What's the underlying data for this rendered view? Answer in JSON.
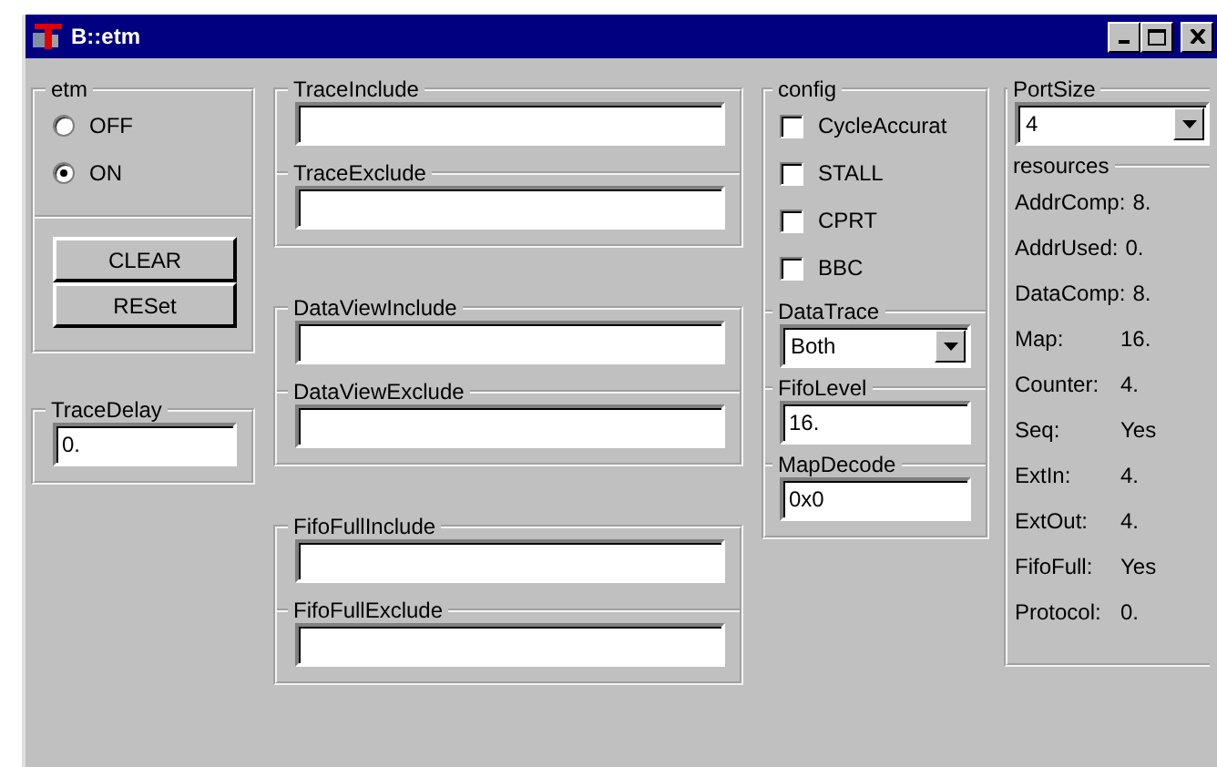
{
  "window": {
    "title": "B::etm"
  },
  "etm": {
    "label": "etm",
    "options": [
      {
        "label": "OFF",
        "selected": false
      },
      {
        "label": "ON",
        "selected": true
      }
    ],
    "buttons": [
      "CLEAR",
      "RESet"
    ]
  },
  "trace_delay": {
    "label": "TraceDelay",
    "value": "0."
  },
  "filter_groups": [
    {
      "fields": [
        {
          "label": "TraceInclude"
        },
        {
          "label": "TraceExclude"
        }
      ]
    },
    {
      "fields": [
        {
          "label": "DataViewInclude"
        },
        {
          "label": "DataViewExclude"
        }
      ]
    },
    {
      "fields": [
        {
          "label": "FifoFullInclude"
        },
        {
          "label": "FifoFullExclude"
        }
      ]
    }
  ],
  "config": {
    "label": "config",
    "options": [
      {
        "label": "CycleAccurat",
        "checked": false
      },
      {
        "label": "STALL",
        "checked": false
      },
      {
        "label": "CPRT",
        "checked": false
      },
      {
        "label": "BBC",
        "checked": false
      }
    ],
    "data_trace": {
      "label": "DataTrace",
      "value": "Both"
    },
    "fifo_level": {
      "label": "FifoLevel",
      "value": "16."
    },
    "map_decode": {
      "label": "MapDecode",
      "value": "0x0"
    }
  },
  "port_size": {
    "label": "PortSize",
    "value": "4"
  },
  "resources": {
    "label": "resources",
    "rows": [
      {
        "name": "AddrComp:",
        "value": "8."
      },
      {
        "name": "AddrUsed:",
        "value": "0."
      },
      {
        "name": "DataComp:",
        "value": "8."
      },
      {
        "name": "Map:",
        "value": "16."
      },
      {
        "name": "Counter:",
        "value": "4."
      },
      {
        "name": "Seq:",
        "value": "Yes"
      },
      {
        "name": "ExtIn:",
        "value": "4."
      },
      {
        "name": "ExtOut:",
        "value": "4."
      },
      {
        "name": "FifoFull:",
        "value": "Yes"
      },
      {
        "name": "Protocol:",
        "value": "0."
      }
    ]
  }
}
